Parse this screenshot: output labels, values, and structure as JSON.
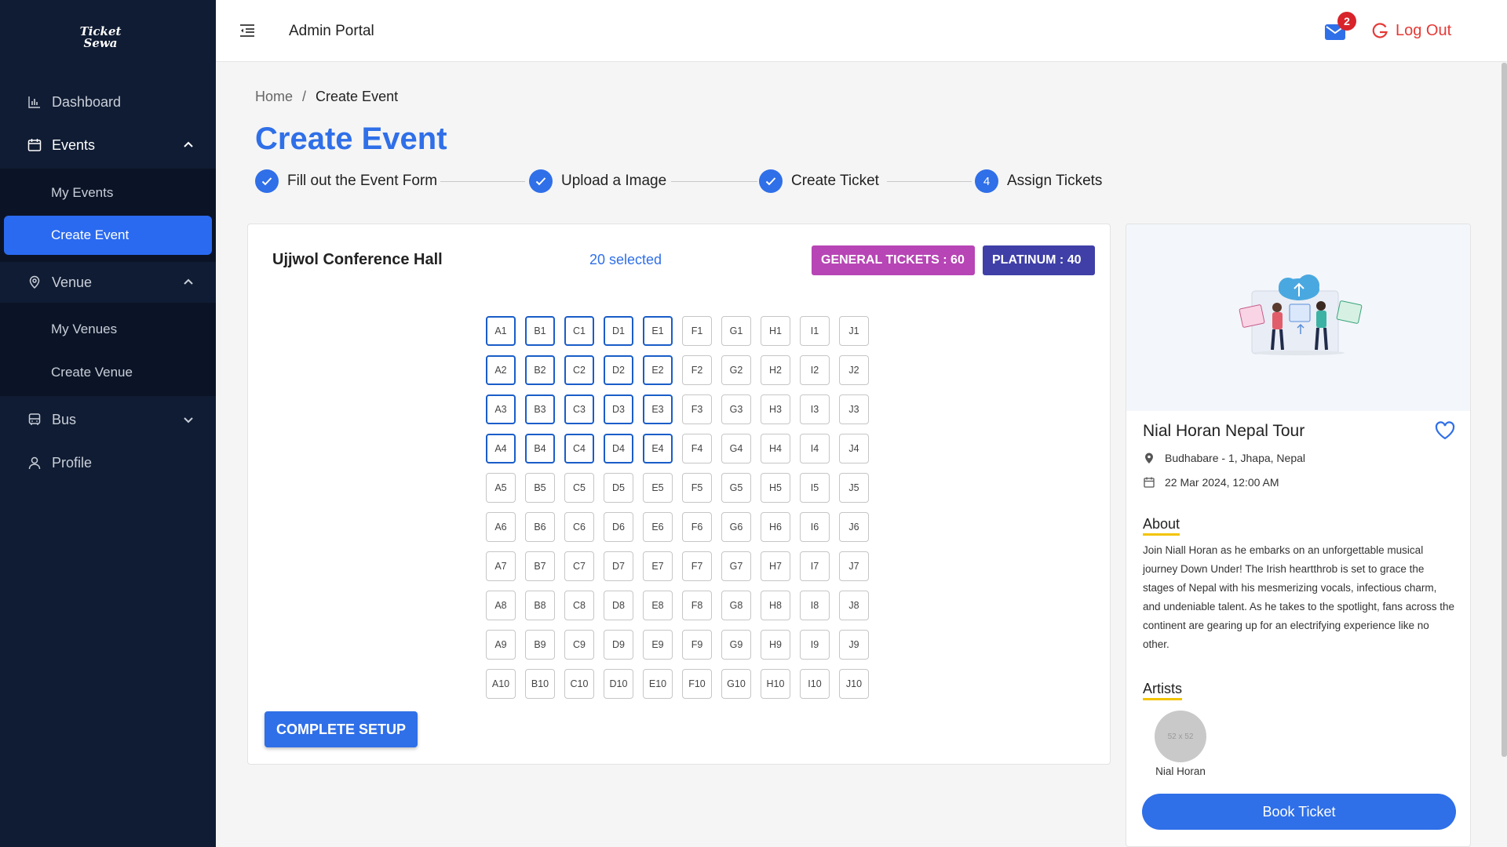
{
  "brand": {
    "logo_line1": "Ticket",
    "logo_line2": "Sewa"
  },
  "sidebar": {
    "items": [
      {
        "label": "Dashboard",
        "icon": "chart-icon"
      },
      {
        "label": "Events",
        "icon": "calendar-icon",
        "expanded": true,
        "children": [
          {
            "label": "My Events"
          },
          {
            "label": "Create Event",
            "active": true
          }
        ]
      },
      {
        "label": "Venue",
        "icon": "location-pin-icon",
        "expanded": true,
        "children": [
          {
            "label": "My Venues"
          },
          {
            "label": "Create Venue"
          }
        ]
      },
      {
        "label": "Bus",
        "icon": "bus-icon",
        "expanded": false
      },
      {
        "label": "Profile",
        "icon": "user-icon"
      }
    ]
  },
  "header": {
    "title": "Admin Portal",
    "mail_count": "2",
    "logout_label": "Log Out"
  },
  "breadcrumb": {
    "home": "Home",
    "separator": "/",
    "current": "Create Event"
  },
  "page": {
    "title": "Create Event"
  },
  "steps": [
    {
      "label": "Fill out the Event Form",
      "status": "done"
    },
    {
      "label": "Upload a Image",
      "status": "done"
    },
    {
      "label": "Create Ticket",
      "status": "done"
    },
    {
      "label": "Assign Tickets",
      "status": "current",
      "number": "4"
    }
  ],
  "seating": {
    "hall_name": "Ujjwol Conference Hall",
    "selected_label": "20 selected",
    "ticket_types": [
      {
        "label": "GENERAL TICKETS : 60",
        "color": "#b745b5"
      },
      {
        "label": "PLATINUM : 40",
        "color": "#3f3fa7"
      }
    ],
    "columns": [
      "A",
      "B",
      "C",
      "D",
      "E",
      "F",
      "G",
      "H",
      "I",
      "J"
    ],
    "rows": 10,
    "selected_seats": [
      "A1",
      "B1",
      "C1",
      "D1",
      "E1",
      "A2",
      "B2",
      "C2",
      "D2",
      "E2",
      "A3",
      "B3",
      "C3",
      "D3",
      "E3",
      "A4",
      "B4",
      "C4",
      "D4",
      "E4"
    ],
    "complete_label": "COMPLETE SETUP"
  },
  "event": {
    "title": "Nial Horan Nepal Tour",
    "location": "Budhabare - 1, Jhapa, Nepal",
    "datetime": "22 Mar 2024, 12:00 AM",
    "about_heading": "About",
    "about_text": "Join Niall Horan as he embarks on an unforgettable musical journey Down Under! The Irish heartthrob is set to grace the stages of Nepal with his mesmerizing vocals, infectious charm, and undeniable talent. As he takes to the spotlight, fans across the continent are gearing up for an electrifying experience like no other.",
    "artists_heading": "Artists",
    "artists": [
      {
        "name": "Nial Horan",
        "placeholder": "52 x 52"
      }
    ],
    "book_label": "Book Ticket"
  },
  "colors": {
    "accent": "#2f6fe8",
    "sidebar": "#101c33",
    "danger": "#e53935",
    "underline": "#f2c400"
  }
}
